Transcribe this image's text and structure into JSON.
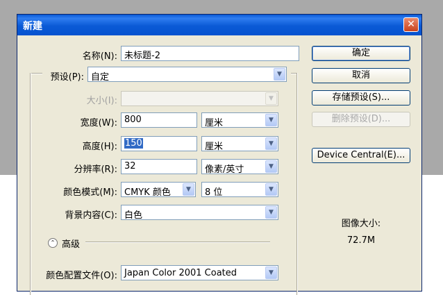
{
  "dialog": {
    "title": "新建",
    "close_glyph": "✕"
  },
  "form": {
    "name_label": "名称(N):",
    "name_value": "未标题-2",
    "preset_label": "预设(P):",
    "preset_value": "自定",
    "size_label": "大小(I):",
    "size_value": "",
    "width_label": "宽度(W):",
    "width_value": "800",
    "width_unit": "厘米",
    "height_label": "高度(H):",
    "height_value": "150",
    "height_unit": "厘米",
    "resolution_label": "分辨率(R):",
    "resolution_value": "32",
    "resolution_unit": "像素/英寸",
    "color_mode_label": "颜色模式(M):",
    "color_mode_value": "CMYK 颜色",
    "bit_depth_value": "8 位",
    "background_label": "背景内容(C):",
    "background_value": "白色",
    "advanced_label": "高级",
    "advanced_icon": "collapse-chevron-icon",
    "profile_label": "颜色配置文件(O):",
    "profile_value": "Japan Color 2001 Coated"
  },
  "buttons": {
    "ok": "确定",
    "cancel": "取消",
    "save_preset": "存储预设(S)...",
    "delete_preset": "删除预设(D)...",
    "device_central": "Device Central(E)..."
  },
  "image_size": {
    "label": "图像大小:",
    "value": "72.7M"
  },
  "colors": {
    "titlebar": "#0a5ad6",
    "dialog_bg": "#ece9d8",
    "selection": "#316ac5",
    "close_button": "#c9431e"
  }
}
